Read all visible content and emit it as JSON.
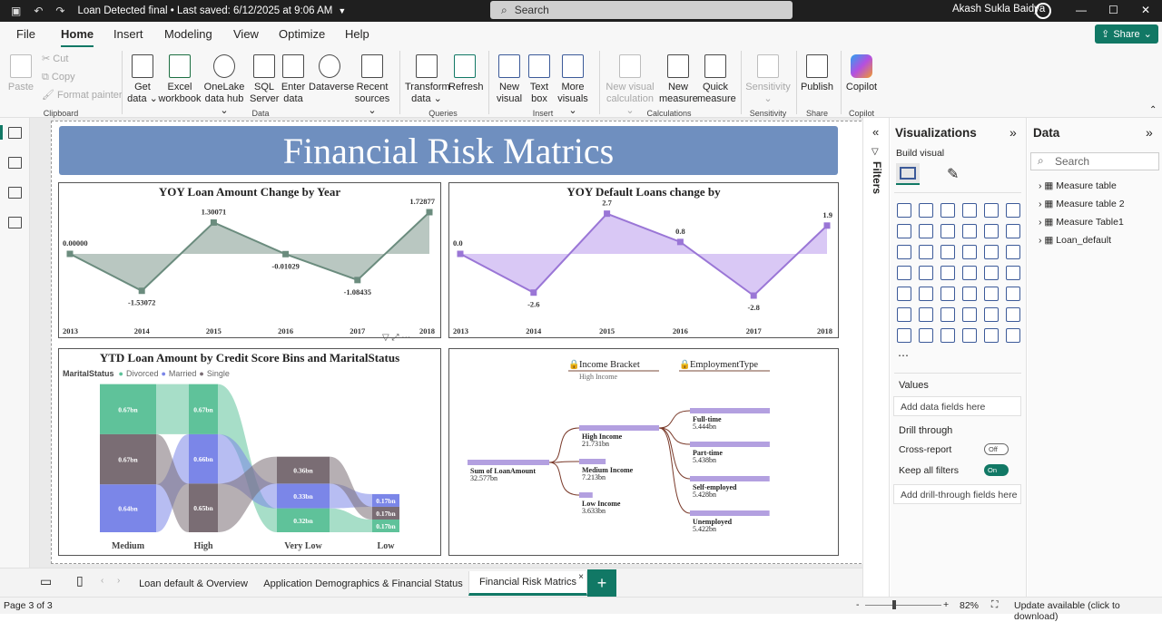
{
  "titlebar": {
    "doc_title": "Loan Detected final • Last saved: 6/12/2025 at 9:06 AM",
    "search_placeholder": "Search",
    "user": "Akash Sukla Baidya"
  },
  "menu": {
    "items": [
      "File",
      "Home",
      "Insert",
      "Modeling",
      "View",
      "Optimize",
      "Help"
    ],
    "active": "Home",
    "share": "Share"
  },
  "ribbon": {
    "clipboard": {
      "paste": "Paste",
      "cut": "Cut",
      "copy": "Copy",
      "format_painter": "Format painter",
      "group": "Clipboard"
    },
    "data": {
      "buttons": [
        {
          "l1": "Get",
          "l2": "data ⌄"
        },
        {
          "l1": "Excel",
          "l2": "workbook"
        },
        {
          "l1": "OneLake",
          "l2": "data hub ⌄"
        },
        {
          "l1": "SQL",
          "l2": "Server"
        },
        {
          "l1": "Enter",
          "l2": "data"
        },
        {
          "l1": "Dataverse",
          "l2": ""
        },
        {
          "l1": "Recent",
          "l2": "sources ⌄"
        }
      ],
      "group": "Data"
    },
    "queries": {
      "buttons": [
        {
          "l1": "Transform",
          "l2": "data ⌄"
        },
        {
          "l1": "Refresh",
          "l2": ""
        }
      ],
      "group": "Queries"
    },
    "insert": {
      "buttons": [
        {
          "l1": "New",
          "l2": "visual"
        },
        {
          "l1": "Text",
          "l2": "box"
        },
        {
          "l1": "More",
          "l2": "visuals ⌄"
        }
      ],
      "group": "Insert"
    },
    "calculations": {
      "buttons": [
        {
          "l1": "New visual",
          "l2": "calculation ⌄"
        },
        {
          "l1": "New",
          "l2": "measure"
        },
        {
          "l1": "Quick",
          "l2": "measure"
        }
      ],
      "group": "Calculations"
    },
    "sensitivity": {
      "buttons": [
        {
          "l1": "Sensitivity",
          "l2": "⌄"
        }
      ],
      "group": "Sensitivity"
    },
    "share": {
      "buttons": [
        {
          "l1": "Publish",
          "l2": ""
        }
      ],
      "group": "Share"
    },
    "copilot": {
      "buttons": [
        {
          "l1": "Copilot",
          "l2": ""
        }
      ],
      "group": "Copilot"
    }
  },
  "report": {
    "title": "Financial Risk Matrics",
    "chart1": {
      "title": "YOY Loan Amount Change by Year"
    },
    "chart2": {
      "title": "YOY Default Loans change by"
    },
    "chart3": {
      "title": "YTD Loan Amount by Credit Score Bins and MaritalStatus",
      "legend_title": "MaritalStatus"
    },
    "tree": {
      "level1": "Income Bracket",
      "level1_sub": "High Income",
      "level2": "EmploymentType",
      "root_label": "Sum of LoanAmount",
      "root_value": "32.577bn",
      "mid": [
        {
          "label": "High Income",
          "value": "21.731bn",
          "share": 0.667
        },
        {
          "label": "Medium Income",
          "value": "7.213bn",
          "share": 0.221
        },
        {
          "label": "Low Income",
          "value": "3.633bn",
          "share": 0.112
        }
      ],
      "leaves": [
        {
          "label": "Full-time",
          "value": "5.444bn",
          "share": 1.0
        },
        {
          "label": "Part-time",
          "value": "5.438bn",
          "share": 0.999
        },
        {
          "label": "Self-employed",
          "value": "5.428bn",
          "share": 0.997
        },
        {
          "label": "Unemployed",
          "value": "5.422bn",
          "share": 0.996
        }
      ]
    }
  },
  "chart_data": [
    {
      "type": "area",
      "title": "YOY Loan Amount Change by Year",
      "x": [
        "2013",
        "2014",
        "2015",
        "2016",
        "2017",
        "2018"
      ],
      "values": [
        0.0,
        -1.53072,
        1.30071,
        -0.01029,
        -1.08435,
        1.72877
      ],
      "labels": [
        "0.00000",
        "-1.53072",
        "1.30071",
        "-0.01029",
        "-1.08435",
        "1.72877"
      ],
      "color": "#6b8c7e",
      "fill": "#b9c7c1"
    },
    {
      "type": "area",
      "title": "YOY Default Loans change by",
      "x": [
        "2013",
        "2014",
        "2015",
        "2016",
        "2017",
        "2018"
      ],
      "values": [
        0.0,
        -2.6,
        2.7,
        0.8,
        -2.8,
        1.9
      ],
      "labels": [
        "0.0",
        "-2.6",
        "2.7",
        "0.8",
        "-2.8",
        "1.9"
      ],
      "color": "#9a76d6",
      "fill": "#d9c8f5"
    },
    {
      "type": "ribbon",
      "title": "YTD Loan Amount by Credit Score Bins and MaritalStatus",
      "categories": [
        "Medium",
        "High",
        "Very Low",
        "Low"
      ],
      "series": [
        {
          "name": "Divorced",
          "color": "#5fc29a",
          "values": [
            0.67,
            0.67,
            0.32,
            0.17
          ],
          "labels": [
            "0.67bn",
            "0.67bn",
            "0.32bn",
            "0.17bn"
          ]
        },
        {
          "name": "Married",
          "color": "#7b86e8",
          "values": [
            0.64,
            0.66,
            0.33,
            0.17
          ],
          "labels": [
            "0.64bn",
            "0.66bn",
            "0.33bn",
            "0.17bn"
          ]
        },
        {
          "name": "Single",
          "color": "#7a6d74",
          "values": [
            0.67,
            0.65,
            0.36,
            0.17
          ],
          "labels": [
            "0.67bn",
            "0.65bn",
            "0.36bn",
            "0.17bn"
          ]
        }
      ]
    }
  ],
  "panes": {
    "filters": "Filters",
    "vis_title": "Visualizations",
    "build_visual": "Build visual",
    "values_label": "Values",
    "values_placeholder": "Add data fields here",
    "drill": "Drill through",
    "cross_report": "Cross-report",
    "cross_state": "Off",
    "keep_filters": "Keep all filters",
    "keep_state": "On",
    "drill_placeholder": "Add drill-through fields here",
    "data_title": "Data",
    "data_search": "Search",
    "tables": [
      "Measure table",
      "Measure table 2",
      "Measure Table1",
      "Loan_default"
    ]
  },
  "tabs": {
    "items": [
      "Loan default & Overview",
      "Application Demographics & Financial Status",
      "Financial Risk Matrics"
    ],
    "active": "Financial Risk Matrics",
    "close": "×",
    "add": "+"
  },
  "status": {
    "page": "Page 3 of 3",
    "zoom": "82%",
    "update": "Update available (click to download)"
  }
}
